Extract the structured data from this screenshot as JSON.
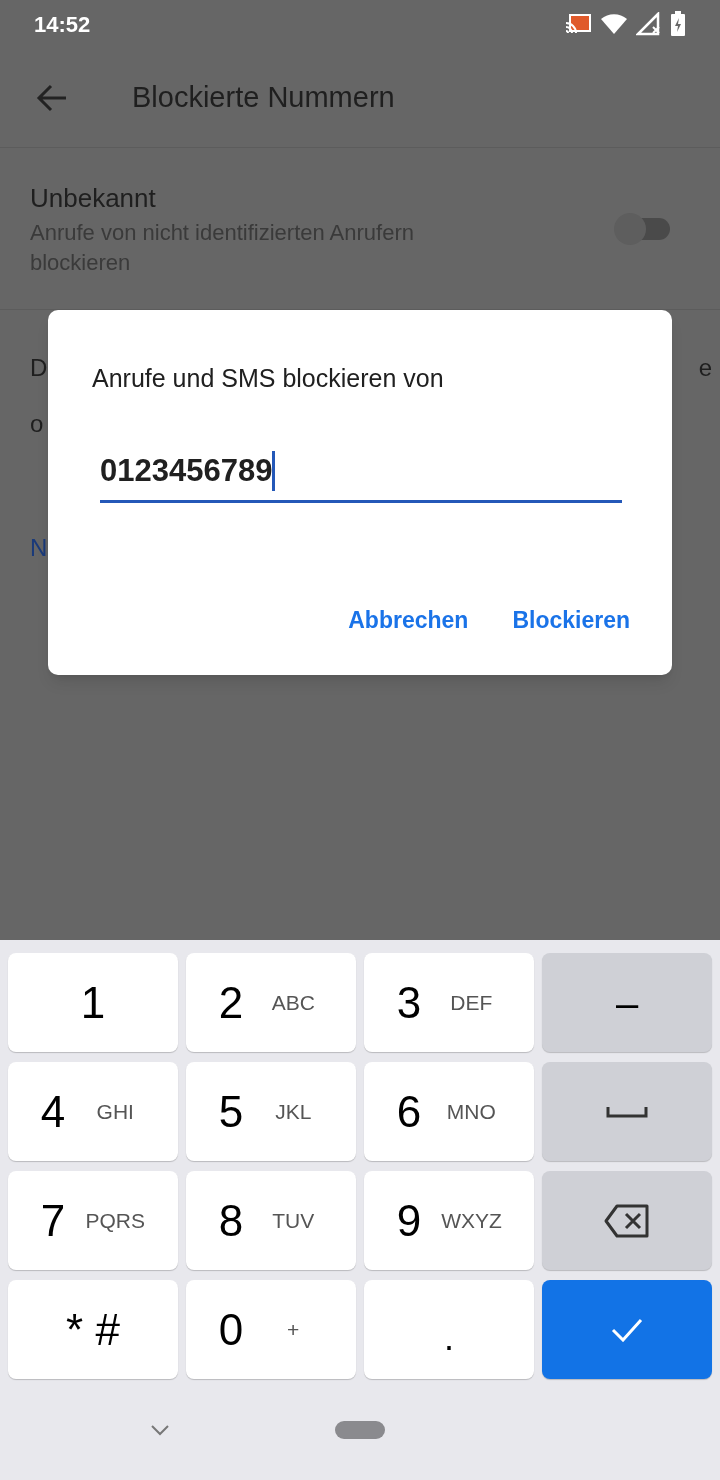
{
  "status_bar": {
    "time": "14:52"
  },
  "app_bar": {
    "title": "Blockierte Nummern"
  },
  "setting": {
    "title": "Unbekannt",
    "subtitle": "Anrufe von nicht identifizierten Anrufern blockieren",
    "on": false
  },
  "covered_text": {
    "line_1_left": "D",
    "line_1_right": "e",
    "line_2_left": "o",
    "link": "N"
  },
  "dialog": {
    "title": "Anrufe und SMS blockieren von",
    "value": "0123456789",
    "buttons": [
      "Abbrechen",
      "Blockieren"
    ]
  },
  "keyboard": {
    "keys": [
      {
        "kind": "digit",
        "label": "1"
      },
      {
        "kind": "digit",
        "label": "2",
        "letters": "ABC"
      },
      {
        "kind": "digit",
        "label": "3",
        "letters": "DEF"
      },
      {
        "kind": "symbol",
        "label": "–"
      },
      {
        "kind": "digit",
        "label": "4",
        "letters": "GHI"
      },
      {
        "kind": "digit",
        "label": "5",
        "letters": "JKL"
      },
      {
        "kind": "digit",
        "label": "6",
        "letters": "MNO"
      },
      {
        "kind": "space"
      },
      {
        "kind": "digit",
        "label": "7",
        "letters": "PQRS"
      },
      {
        "kind": "digit",
        "label": "8",
        "letters": "TUV"
      },
      {
        "kind": "digit",
        "label": "9",
        "letters": "WXYZ"
      },
      {
        "kind": "backspace"
      },
      {
        "kind": "digit",
        "label": "* #"
      },
      {
        "kind": "digit",
        "label": "0",
        "letters": "+"
      },
      {
        "kind": "dot",
        "label": "."
      },
      {
        "kind": "done"
      }
    ]
  }
}
